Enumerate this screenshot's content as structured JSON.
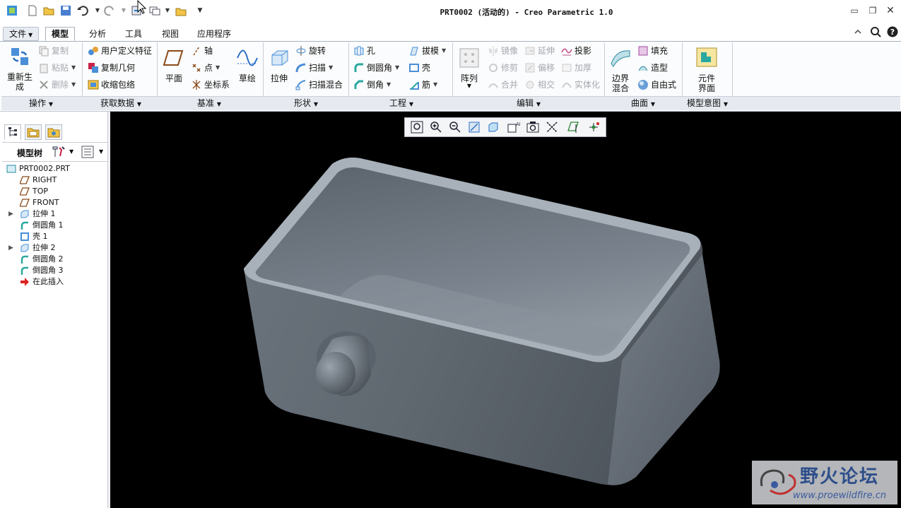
{
  "window": {
    "title": "PRT0002 (活动的) - Creo Parametric 1.0"
  },
  "tabs": [
    {
      "label": "文件"
    },
    {
      "label": "模型"
    },
    {
      "label": "分析"
    },
    {
      "label": "工具"
    },
    {
      "label": "视图"
    },
    {
      "label": "应用程序"
    }
  ],
  "ribbon": {
    "regenerate": "重新生成",
    "copy": "复制",
    "paste": "粘贴",
    "delete": "删除",
    "udf": "用户定义特征",
    "copy_geom": "复制几何",
    "shrinkwrap": "收缩包络",
    "plane": "平面",
    "axis": "轴",
    "point": "点",
    "csys": "坐标系",
    "sketch": "草绘",
    "extrude": "拉伸",
    "revolve": "旋转",
    "sweep": "扫描",
    "swept_blend": "扫描混合",
    "hole": "孔",
    "round": "倒圆角",
    "chamfer": "倒角",
    "draft": "拔模",
    "shell": "壳",
    "rib": "筋",
    "pattern": "阵列",
    "mirror": "镜像",
    "trim": "修剪",
    "merge": "合并",
    "extend": "延伸",
    "offset": "偏移",
    "intersect": "相交",
    "project": "投影",
    "thicken": "加厚",
    "solidify": "实体化",
    "boundary_blend": "边界混合",
    "fill": "填充",
    "style": "造型",
    "freestyle": "自由式",
    "component_interface": "元件界面",
    "groups": [
      "操作",
      "获取数据",
      "基准",
      "形状",
      "工程",
      "编辑",
      "曲面",
      "模型意图"
    ]
  },
  "model_tree": {
    "header": "模型树",
    "items": [
      {
        "label": "PRT0002.PRT"
      },
      {
        "label": "RIGHT"
      },
      {
        "label": "TOP"
      },
      {
        "label": "FRONT"
      },
      {
        "label": "拉伸 1"
      },
      {
        "label": "倒圆角 1"
      },
      {
        "label": "壳 1"
      },
      {
        "label": "拉伸 2"
      },
      {
        "label": "倒圆角 2"
      },
      {
        "label": "倒圆角 3"
      },
      {
        "label": "在此插入"
      }
    ]
  },
  "watermark": {
    "name": "野火论坛",
    "url": "www.proewildfire.cn"
  },
  "colors": {
    "accent": "#2a7fd4",
    "viewport_bg": "#000000",
    "part": "#6e7680"
  }
}
